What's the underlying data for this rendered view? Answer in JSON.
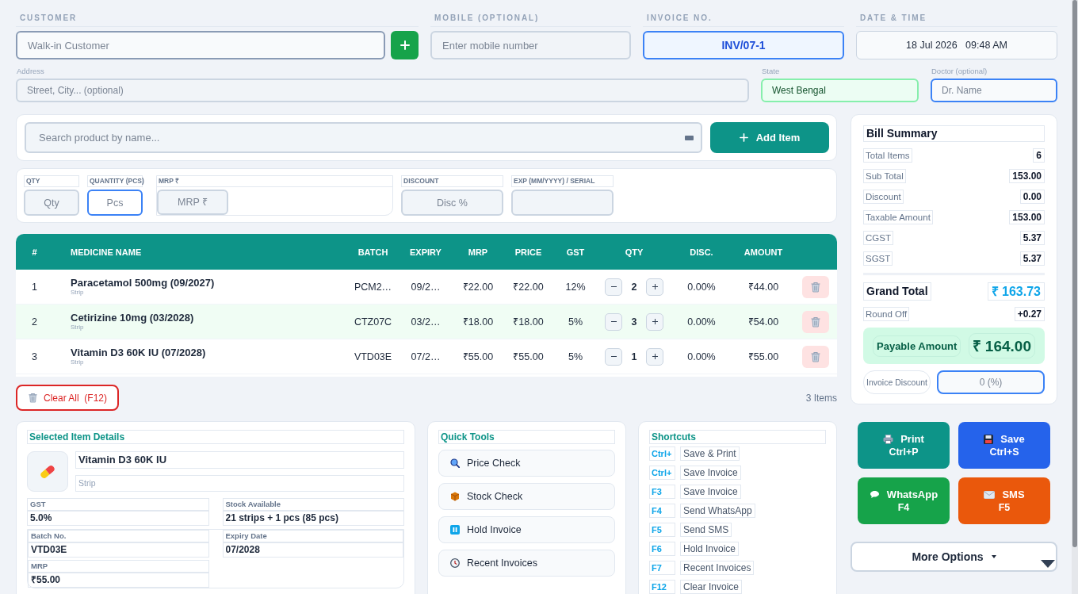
{
  "customer": {
    "label": "CUSTOMER",
    "placeholder": "Walk-in Customer"
  },
  "mobile": {
    "label": "MOBILE (OPTIONAL)",
    "placeholder": "Enter mobile number"
  },
  "invoice_no": {
    "label": "INVOICE NO.",
    "value": "INV/07-1"
  },
  "date_time": {
    "label": "DATE & TIME",
    "value": "18 Jul 2026   09:48 AM"
  },
  "address": {
    "label": "Address",
    "placeholder": "Street, City... (optional)"
  },
  "state": {
    "label": "State",
    "value": "West Bengal"
  },
  "doctor": {
    "label": "Doctor (optional)",
    "placeholder": "Dr. Name"
  },
  "product_search": {
    "placeholder": "Search product by name...",
    "add_button": "Add Item"
  },
  "entry_fields": [
    {
      "label": "QTY",
      "placeholder": "Qty",
      "kind": "compact",
      "focused": false
    },
    {
      "label": "QUANTITY (PCS)",
      "placeholder": "Pcs",
      "kind": "compact",
      "focused": true
    },
    {
      "label": "MRP ₹",
      "placeholder": "MRP ₹",
      "kind": "wide",
      "focused": false
    },
    {
      "label": "DISCOUNT",
      "placeholder": "Disc %",
      "kind": "medium",
      "focused": false
    },
    {
      "label": "EXP (MM/YYYY) / SERIAL",
      "kind": "medium",
      "focused": false
    }
  ],
  "table": {
    "columns": [
      "#",
      "MEDICINE NAME",
      "BATCH",
      "EXPIRY",
      "MRP",
      "PRICE",
      "GST",
      "QTY",
      "DISC.",
      "AMOUNT"
    ],
    "rows": [
      {
        "index": "1",
        "name": "Paracetamol 500mg (09/2027)",
        "unit": "Strip",
        "batch": "PCM2…",
        "expiry": "09/2…",
        "mrp": "₹22.00",
        "price": "₹22.00",
        "gst": "12%",
        "qty": "2",
        "disc": "0.00%",
        "amount": "₹44.00"
      },
      {
        "index": "2",
        "name": "Cetirizine 10mg (03/2028)",
        "unit": "Strip",
        "batch": "CTZ07C",
        "expiry": "03/2…",
        "mrp": "₹18.00",
        "price": "₹18.00",
        "gst": "5%",
        "qty": "3",
        "disc": "0.00%",
        "amount": "₹54.00"
      },
      {
        "index": "3",
        "name": "Vitamin D3 60K IU (07/2028)",
        "unit": "Strip",
        "batch": "VTD03E",
        "expiry": "07/2…",
        "mrp": "₹55.00",
        "price": "₹55.00",
        "gst": "5%",
        "qty": "1",
        "disc": "0.00%",
        "amount": "₹55.00"
      }
    ]
  },
  "clear_all_button": "Clear All  (F12)",
  "items_count": "3 Items",
  "selected_item": {
    "title": "Selected Item Details",
    "name": "Vitamin D3 60K IU",
    "unit": "Strip",
    "fields": [
      {
        "label": "GST",
        "value": "5.0%"
      },
      {
        "label": "Stock Available",
        "value": "21 strips + 1 pcs (85 pcs)"
      },
      {
        "label": "Batch No.",
        "value": "VTD03E"
      },
      {
        "label": "Expiry Date",
        "value": "07/2028"
      },
      {
        "label": "MRP",
        "value": "₹55.00"
      }
    ]
  },
  "quick_tools": {
    "title": "Quick Tools",
    "items": [
      {
        "label": "Price Check"
      },
      {
        "label": "Stock Check"
      },
      {
        "label": "Hold Invoice"
      },
      {
        "label": "Recent Invoices"
      }
    ]
  },
  "shortcuts": {
    "title": "Shortcuts",
    "items": [
      {
        "key": "Ctrl+",
        "action": "Save & Print"
      },
      {
        "key": "Ctrl+",
        "action": "Save Invoice"
      },
      {
        "key": "F3",
        "action": "Save Invoice"
      },
      {
        "key": "F4",
        "action": "Send WhatsApp"
      },
      {
        "key": "F5",
        "action": "Send SMS"
      },
      {
        "key": "F6",
        "action": "Hold Invoice"
      },
      {
        "key": "F7",
        "action": "Recent Invoices"
      },
      {
        "key": "F12",
        "action": "Clear Invoice"
      }
    ]
  },
  "bill_summary": {
    "title": "Bill Summary",
    "rows": [
      {
        "label": "Total Items",
        "value": "6"
      },
      {
        "label": "Sub Total",
        "value": "153.00"
      },
      {
        "label": "Discount",
        "value": "0.00"
      },
      {
        "label": "Taxable Amount",
        "value": "153.00"
      },
      {
        "label": "CGST",
        "value": "5.37"
      },
      {
        "label": "SGST",
        "value": "5.37"
      }
    ],
    "grand_total": {
      "label": "Grand Total",
      "value": "₹ 163.73"
    },
    "round_off": {
      "label": "Round Off",
      "value": "+0.27"
    },
    "payable": {
      "label": "Payable Amount",
      "value": "₹ 164.00"
    },
    "invoice_discount": {
      "label": "Invoice Discount",
      "placeholder": "0 (%)"
    }
  },
  "action_buttons": [
    {
      "label": "Print",
      "shortcut": "Ctrl+P",
      "color": "#0d9488"
    },
    {
      "label": "Save",
      "shortcut": "Ctrl+S",
      "color": "#2563eb"
    },
    {
      "label": "WhatsApp",
      "shortcut": "F4",
      "color": "#16a34a"
    },
    {
      "label": "SMS",
      "shortcut": "F5",
      "color": "#ea580c"
    }
  ],
  "more_options": {
    "label": "More Options"
  }
}
